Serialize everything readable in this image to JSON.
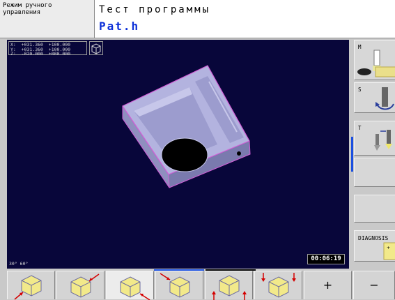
{
  "header": {
    "mode_label": "Режим ручного управления",
    "title": "Тест программы",
    "file_name": "Pat.h"
  },
  "viewport": {
    "coords": "X:  +031.360  +100.000\nY:  +031.360  +100.000\nZ:  -020.000  +000.000",
    "angles": "30°  60°",
    "timer": "00:06:19"
  },
  "right_strip": {
    "items": [
      {
        "label": "M",
        "icon": "spindle-icon"
      },
      {
        "label": "S",
        "icon": "spindle-rotation-icon"
      },
      {
        "label": "T",
        "icon": "tool-change-icon"
      },
      {
        "label": "",
        "icon": ""
      },
      {
        "label": "",
        "icon": ""
      },
      {
        "label": "DIAGNOSIS",
        "icon": "diagnosis-icon"
      }
    ]
  },
  "softkeys": [
    {
      "name": "view-front-left-icon"
    },
    {
      "name": "view-top-right-icon"
    },
    {
      "name": "view-bottom-right-icon"
    },
    {
      "name": "view-top-left-icon"
    },
    {
      "name": "view-bottom-up-icon"
    },
    {
      "name": "view-top-down-icon"
    },
    {
      "label": "+"
    },
    {
      "label": "−"
    }
  ],
  "colors": {
    "viewport_bg": "#08063a",
    "model_fill": "#b3b3df",
    "model_edge": "#d25cd6",
    "file_name": "#0b2fd8",
    "accent_bar": "#1a4fe0"
  }
}
